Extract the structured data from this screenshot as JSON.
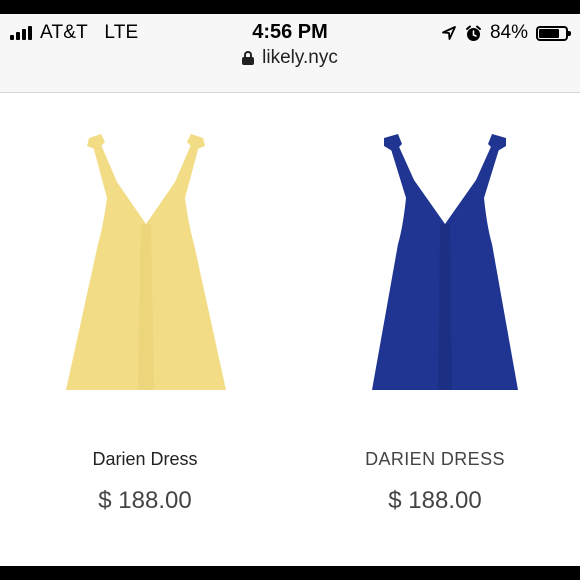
{
  "status_bar": {
    "carrier": "AT&T",
    "network": "LTE",
    "time": "4:56 PM",
    "battery_percent": "84%",
    "battery_level": 0.84,
    "icons": [
      "signal-icon",
      "location-arrow-icon",
      "alarm-clock-icon",
      "battery-icon"
    ]
  },
  "browser": {
    "url": "likely.nyc"
  },
  "products": [
    {
      "name": "Darien Dress",
      "price": "$ 188.00",
      "color": "#f2dd86",
      "shade": "#e6cd6e"
    },
    {
      "name": "DARIEN DRESS",
      "price": "$ 188.00",
      "color": "#1f3591",
      "shade": "#172a78"
    }
  ]
}
